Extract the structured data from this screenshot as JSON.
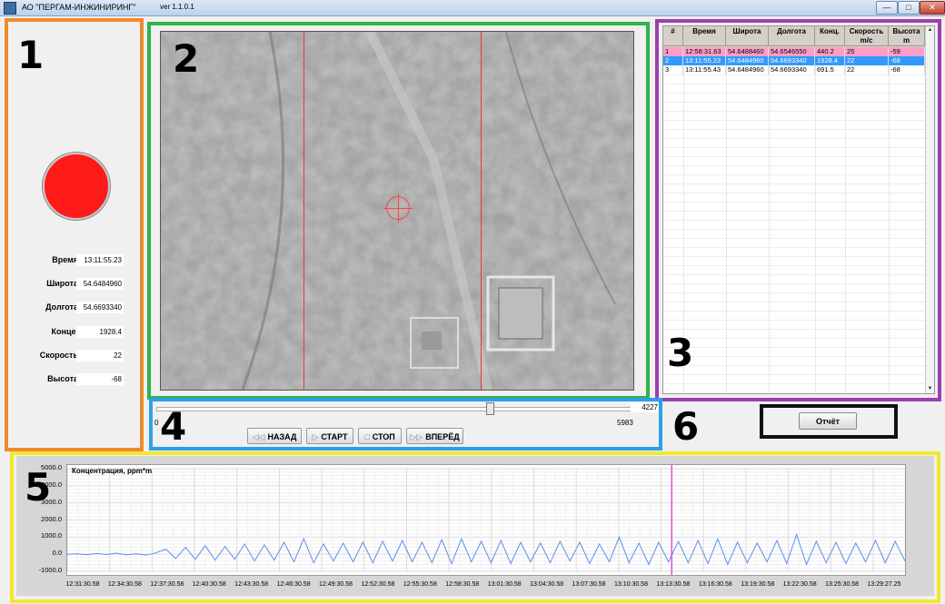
{
  "window": {
    "title": "АО \"ПЕРГАМ-ИНЖИНИРИНГ\"",
    "version": "ver  1.1.0.1",
    "btn_minimize": "—",
    "btn_maximize": "□",
    "btn_close": "✕"
  },
  "panel_labels": [
    "1",
    "2",
    "3",
    "4",
    "5",
    "6"
  ],
  "colors": {
    "panel1": "#f08a2e",
    "panel2": "#2fb34a",
    "panel3": "#9b3fb1",
    "panel4": "#2aa1e8",
    "panel5": "#f2e82a",
    "panel6": "#111111",
    "alarm": "#ff1a1a",
    "row_alarm": "#ff9fc7",
    "row_selected": "#3399ff",
    "signal": "#5b8ff0",
    "marker": "#d62ad6"
  },
  "status": {
    "indicator": "red-alarm-indicator",
    "fields": [
      {
        "label": "Время",
        "value": "13:11:55.23"
      },
      {
        "label": "Широта",
        "value": "54.6484960"
      },
      {
        "label": "Долгота",
        "value": "54.6693340"
      },
      {
        "label": "Конце.",
        "value": "1928.4"
      },
      {
        "label": "Скорость",
        "value": "22"
      },
      {
        "label": "Высота",
        "value": "-68"
      }
    ]
  },
  "table": {
    "headers": [
      "#",
      "Время",
      "Широта",
      "Долгота",
      "Конц.",
      "Скорость m/c",
      "Высота m"
    ],
    "rows": [
      [
        "1",
        "12:58:31.63",
        "54.6488460",
        "54.6546550",
        "440.2",
        "25",
        "-59"
      ],
      [
        "2",
        "13:11:55.23",
        "54.6484960",
        "54.6693340",
        "1928.4",
        "22",
        "-68"
      ],
      [
        "3",
        "13:11:55.43",
        "54.6484960",
        "54.6693340",
        "691.5",
        "22",
        "-68"
      ]
    ]
  },
  "player": {
    "min": "0",
    "max": "5983",
    "current": "4227",
    "position_fraction": 0.7065,
    "buttons": [
      {
        "label": "НАЗАД",
        "icon": "◁◁"
      },
      {
        "label": "СТАРТ",
        "icon": "▷"
      },
      {
        "label": "СТОП",
        "icon": "□"
      },
      {
        "label": "ВПЕРЁД",
        "icon": "▷▷"
      }
    ]
  },
  "report_button": "Отчёт",
  "chart_data": {
    "type": "line",
    "title": "Концентрация, ppm*m",
    "ylim": [
      -1000,
      5000
    ],
    "yticks": [
      "5000.0",
      "4000.0",
      "3000.0",
      "2000.0",
      "1000.0",
      "0.0",
      "-1000.0"
    ],
    "xticks": [
      "12:31:30.58",
      "12:34:30.58",
      "12:37:30.58",
      "12:40:30.58",
      "12:43:30.58",
      "12:46:30.58",
      "12:49:30.58",
      "12:52:30.58",
      "12:55:30.58",
      "12:58:30.58",
      "13:01:30.58",
      "13:04:30.58",
      "13:07:30.58",
      "13:10:30.58",
      "13:13:30.58",
      "13:16:30.58",
      "13:19:30.58",
      "13:22:30.58",
      "13:25:30.58",
      "13:29:27.25"
    ],
    "marker_time": "13:11:55",
    "grid": true,
    "series": [
      {
        "values": [
          0,
          20,
          -30,
          40,
          -20,
          60,
          -40,
          30,
          -60,
          80,
          300,
          -250,
          400,
          -300,
          500,
          -350,
          450,
          -300,
          600,
          -400,
          550,
          -350,
          700,
          -450,
          900,
          -500,
          600,
          -400,
          650,
          -450,
          700,
          -500,
          750,
          -400,
          800,
          -450,
          700,
          -500,
          850,
          -550,
          900,
          -450,
          750,
          -500,
          800,
          -550,
          700,
          -450,
          650,
          -500,
          750,
          -400,
          700,
          -550,
          600,
          -450,
          1000,
          -500,
          650,
          -600,
          700,
          -450,
          750,
          -500,
          800,
          -550,
          900,
          -600,
          700,
          -500,
          650,
          -450,
          800,
          -550,
          1150,
          -600,
          750,
          -500,
          700,
          -550,
          650,
          -450,
          800,
          -500,
          750,
          -400
        ]
      }
    ]
  }
}
